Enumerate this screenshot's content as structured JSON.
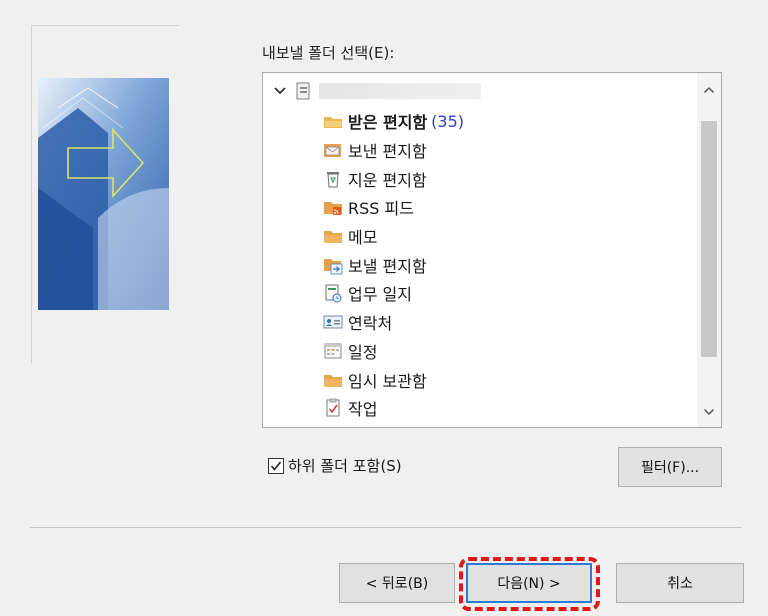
{
  "export": {
    "label": "내보낼 폴더 선택(E):"
  },
  "tree": {
    "root_icon": "pst-file-icon",
    "items": [
      {
        "label": "받은 편지함",
        "count": "(35)",
        "icon": "inbox-folder-icon",
        "selected": true
      },
      {
        "label": "보낸 편지함",
        "icon": "sent-items-icon"
      },
      {
        "label": "지운 편지함",
        "icon": "deleted-items-icon"
      },
      {
        "label": "RSS 피드",
        "icon": "rss-feed-icon"
      },
      {
        "label": "메모",
        "icon": "notes-folder-icon"
      },
      {
        "label": "보낼 편지함",
        "icon": "outbox-icon"
      },
      {
        "label": "업무 일지",
        "icon": "journal-icon"
      },
      {
        "label": "연락처",
        "icon": "contacts-icon"
      },
      {
        "label": "일정",
        "icon": "calendar-icon"
      },
      {
        "label": "임시 보관함",
        "icon": "drafts-folder-icon"
      },
      {
        "label": "작업",
        "icon": "tasks-icon"
      }
    ]
  },
  "options": {
    "include_subfolders_label": "하위 폴더 포함(S)",
    "include_subfolders_checked": true,
    "filter_label": "필터(F)..."
  },
  "buttons": {
    "back": "< 뒤로(B)",
    "next": "다음(N) >",
    "cancel": "취소"
  },
  "colors": {
    "count": "#2a3fcc",
    "highlight": "#e01818",
    "focus_border": "#2a7bd4"
  }
}
